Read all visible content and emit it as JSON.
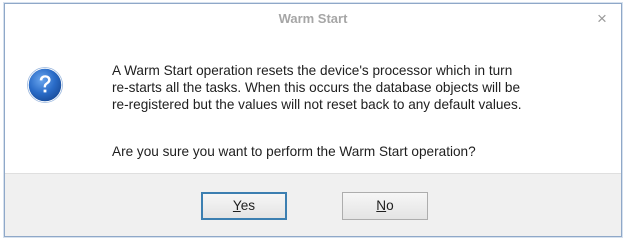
{
  "dialog": {
    "title": "Warm Start",
    "close_glyph": "×",
    "icon": "question-icon",
    "message": "A Warm Start operation resets the device's processor which in turn\nre-starts all the tasks. When this occurs the database objects will be\nre-registered but the values will not reset back to any default values.",
    "question": "Are you sure you want to perform the Warm Start operation?",
    "buttons": {
      "yes_mnemonic": "Y",
      "yes_rest": "es",
      "no_mnemonic": "N",
      "no_rest": "o"
    }
  },
  "colors": {
    "title_text": "#a6a6a6",
    "icon_blue": "#2a6cc8",
    "default_button_border": "#3c7fb1",
    "footer_bg": "#f0f0f0"
  }
}
